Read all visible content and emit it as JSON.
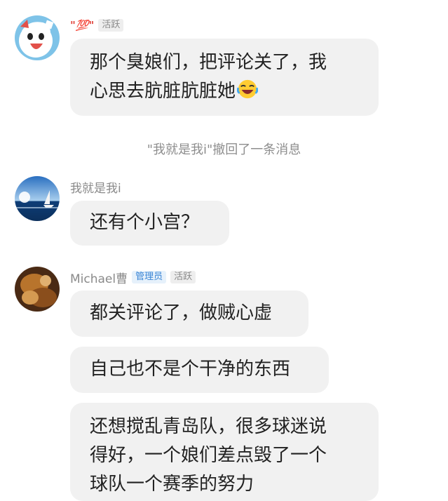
{
  "messages": [
    {
      "name": "\"💯\"",
      "badges": [
        "活跃"
      ],
      "lines": [
        "那个臭娘们，把评论关了，我",
        "心思去肮脏肮脏她"
      ],
      "trailing_emoji": "laughing-crying-emoji"
    },
    {
      "system": "\"我就是我i\"撤回了一条消息"
    },
    {
      "name": "我就是我i",
      "badges": [],
      "lines": [
        "还有个小宫？"
      ]
    },
    {
      "name": "Michael曹",
      "badges": [
        "管理员",
        "活跃"
      ],
      "bubbles": [
        {
          "lines": [
            "都关评论了，做贼心虚"
          ]
        },
        {
          "lines": [
            "自己也不是个干净的东西"
          ]
        },
        {
          "lines": [
            "还想搅乱青岛队，很多球迷说",
            "得好，一个娘们差点毁了一个",
            "球队一个赛季的努力"
          ]
        }
      ]
    }
  ],
  "colors": {
    "bubble_bg": "#f1f1f1",
    "admin_badge": "#3b86d6",
    "name_text": "#8a8a8a"
  }
}
